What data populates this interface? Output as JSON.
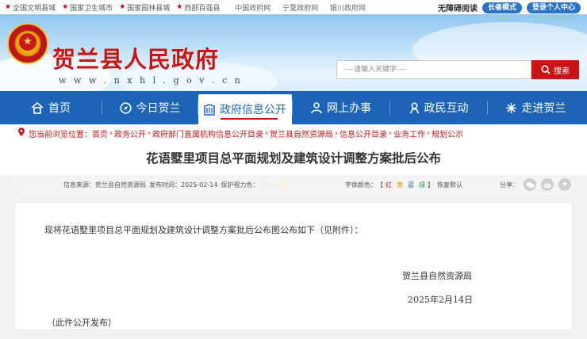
{
  "topbar": {
    "honors": [
      "全国文明县城",
      "国家卫生城市",
      "国家园林县城",
      "西部百强县"
    ],
    "sites": [
      "中国政府网",
      "宁夏政府网",
      "银川政府网"
    ],
    "accessibility": "无障碍阅读",
    "elder_mode": "长者模式",
    "login": "登录个人中心"
  },
  "header": {
    "site_title": "贺兰县人民政府",
    "site_url": "w w w . n x h l . g o v . c n",
    "search_placeholder": "----请输入关键字----",
    "search_button": "搜索"
  },
  "nav": {
    "items": [
      {
        "label": "首页",
        "icon": "home-icon"
      },
      {
        "label": "今日贺兰",
        "icon": "compass-icon"
      },
      {
        "label": "政府信息公开",
        "icon": "building-icon"
      },
      {
        "label": "网上办事",
        "icon": "person-icon"
      },
      {
        "label": "政民互动",
        "icon": "chat-icon"
      },
      {
        "label": "走进贺兰",
        "icon": "flower-icon"
      }
    ]
  },
  "breadcrumb": {
    "prefix": "您当前浏览位置：",
    "items": [
      "首页",
      "政务公开",
      "政府部门直属机构信息公开目录",
      "贺兰县自然资源局",
      "信息公开目录",
      "业务工作",
      "规划公示"
    ]
  },
  "article": {
    "title": "花语墅里项目总平面规划及建筑设计调整方案批后公布",
    "source": "信息来源：贺兰县自然资源局",
    "publish_time": "发布时间：2025-02-14",
    "vision": "保护视力色：",
    "font_color_label": "字体颜色：",
    "font_colors": [
      "红",
      "黄",
      "蓝",
      "绿"
    ],
    "reset": "恢复默认",
    "share_label": "分享：",
    "body": "现将花语墅里项目总平面规划及建筑设计调整方案批后公布图公布如下（见附件）：",
    "org": "贺兰县自然资源局",
    "date": "2025年2月14日",
    "note": "（此件公开发布）"
  },
  "colors": {
    "brand_red": "#c81414",
    "nav_blue": "#1c64b8",
    "vision_swatches": [
      "#e8f0f8",
      "#eef5e8",
      "#f8f2e2"
    ]
  }
}
